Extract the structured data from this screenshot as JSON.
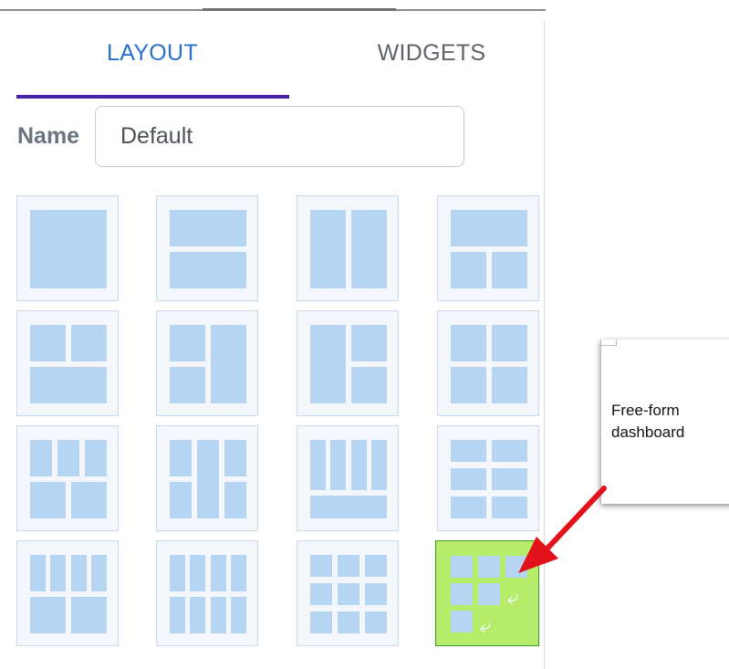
{
  "tabs": [
    {
      "label": "LAYOUT",
      "active": true
    },
    {
      "label": "WIDGETS",
      "active": false
    }
  ],
  "name_field": {
    "label": "Name",
    "value": "Default"
  },
  "layouts": [
    {
      "id": "single",
      "selected": false
    },
    {
      "id": "two-rows",
      "selected": false
    },
    {
      "id": "two-columns",
      "selected": false
    },
    {
      "id": "top-row-two-bottom",
      "selected": false
    },
    {
      "id": "two-top-row-bottom",
      "selected": false
    },
    {
      "id": "two-left-column-right",
      "selected": false
    },
    {
      "id": "column-left-two-right",
      "selected": false
    },
    {
      "id": "two-by-two-grid",
      "selected": false
    },
    {
      "id": "three-top-two-bottom",
      "selected": false
    },
    {
      "id": "wide-center-column-sides",
      "selected": false
    },
    {
      "id": "four-top-row-bottom",
      "selected": false
    },
    {
      "id": "two-columns-three-rows",
      "selected": false
    },
    {
      "id": "four-top-two-bottom",
      "selected": false
    },
    {
      "id": "four-by-two-grid",
      "selected": false
    },
    {
      "id": "three-by-three-grid",
      "selected": false
    },
    {
      "id": "free-form",
      "selected": true
    }
  ],
  "callout": {
    "text": "Free-form dashboard"
  },
  "colors": {
    "accent_tab": "#2a6fc9",
    "tab_underline": "#4a22a8",
    "tile_fill": "#b5d5f2",
    "tile_bg": "#f3f7fc",
    "selected_bg": "#b6ec6a",
    "selected_border": "#3d9b2a",
    "arrow": "#e3121a"
  }
}
